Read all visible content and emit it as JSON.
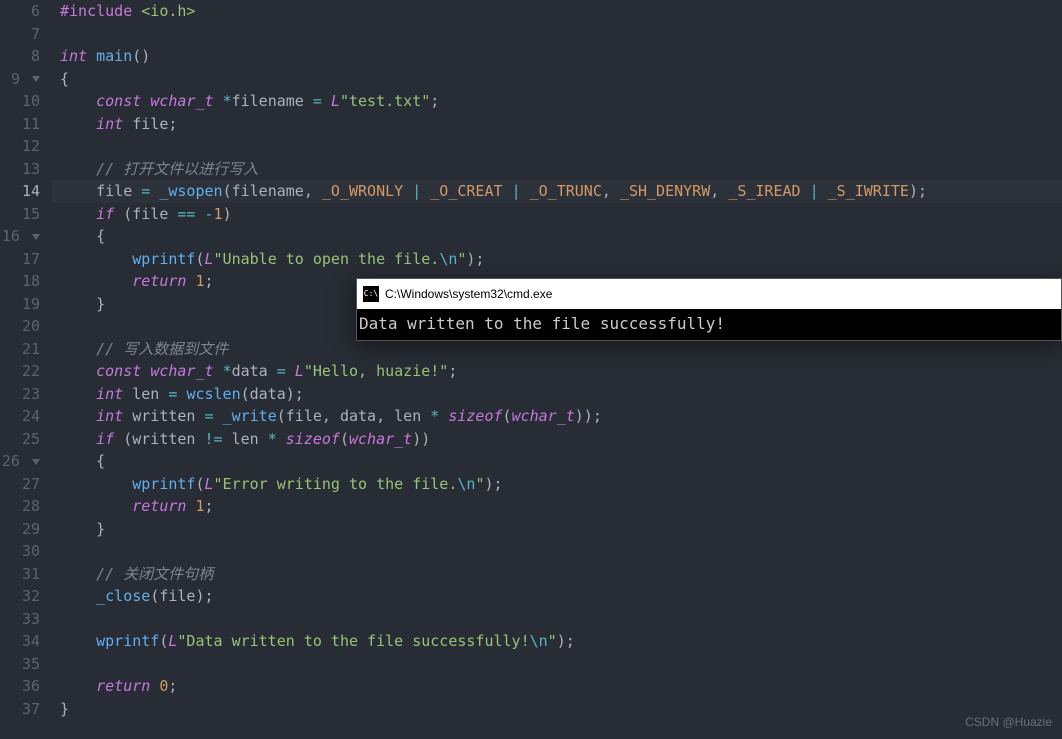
{
  "gutter": {
    "start": 6,
    "end": 37,
    "activeLine": 14,
    "foldLines": [
      9,
      16,
      26
    ]
  },
  "code": {
    "lines": [
      {
        "num": 6,
        "tokens": [
          [
            "preproc",
            "#include"
          ],
          [
            "plain",
            " "
          ],
          [
            "incstr",
            "<io.h>"
          ]
        ]
      },
      {
        "num": 7,
        "tokens": []
      },
      {
        "num": 8,
        "tokens": [
          [
            "type",
            "int"
          ],
          [
            "plain",
            " "
          ],
          [
            "func",
            "main"
          ],
          [
            "punc",
            "()"
          ]
        ]
      },
      {
        "num": 9,
        "tokens": [
          [
            "punc",
            "{"
          ]
        ]
      },
      {
        "num": 10,
        "tokens": [
          [
            "plain",
            "    "
          ],
          [
            "kw",
            "const"
          ],
          [
            "plain",
            " "
          ],
          [
            "type",
            "wchar_t"
          ],
          [
            "plain",
            " "
          ],
          [
            "op",
            "*"
          ],
          [
            "plain",
            "filename "
          ],
          [
            "op",
            "="
          ],
          [
            "plain",
            " "
          ],
          [
            "strprefix",
            "L"
          ],
          [
            "str",
            "\"test.txt\""
          ],
          [
            "punc",
            ";"
          ]
        ]
      },
      {
        "num": 11,
        "tokens": [
          [
            "plain",
            "    "
          ],
          [
            "type",
            "int"
          ],
          [
            "plain",
            " file"
          ],
          [
            "punc",
            ";"
          ]
        ]
      },
      {
        "num": 12,
        "tokens": []
      },
      {
        "num": 13,
        "tokens": [
          [
            "plain",
            "    "
          ],
          [
            "cmt",
            "// 打开文件以进行写入"
          ]
        ]
      },
      {
        "num": 14,
        "highlight": true,
        "tokens": [
          [
            "plain",
            "    file "
          ],
          [
            "op",
            "="
          ],
          [
            "plain",
            " "
          ],
          [
            "func",
            "_wsopen"
          ],
          [
            "punc",
            "("
          ],
          [
            "plain",
            "filename"
          ],
          [
            "punc",
            ", "
          ],
          [
            "const",
            "_O_WRONLY"
          ],
          [
            "plain",
            " "
          ],
          [
            "op",
            "|"
          ],
          [
            "plain",
            " "
          ],
          [
            "const",
            "_O_CREAT"
          ],
          [
            "plain",
            " "
          ],
          [
            "op",
            "|"
          ],
          [
            "plain",
            " "
          ],
          [
            "const",
            "_O_TRUNC"
          ],
          [
            "punc",
            ", "
          ],
          [
            "const",
            "_SH_DENYRW"
          ],
          [
            "punc",
            ", "
          ],
          [
            "const",
            "_S_IREAD"
          ],
          [
            "plain",
            " "
          ],
          [
            "op",
            "|"
          ],
          [
            "plain",
            " "
          ],
          [
            "const",
            "_S_IWRITE"
          ],
          [
            "punc",
            ");"
          ]
        ]
      },
      {
        "num": 15,
        "tokens": [
          [
            "plain",
            "    "
          ],
          [
            "kw",
            "if"
          ],
          [
            "plain",
            " "
          ],
          [
            "punc",
            "("
          ],
          [
            "plain",
            "file "
          ],
          [
            "op",
            "=="
          ],
          [
            "plain",
            " "
          ],
          [
            "op",
            "-"
          ],
          [
            "num",
            "1"
          ],
          [
            "punc",
            ")"
          ]
        ]
      },
      {
        "num": 16,
        "tokens": [
          [
            "plain",
            "    "
          ],
          [
            "punc",
            "{"
          ]
        ]
      },
      {
        "num": 17,
        "tokens": [
          [
            "plain",
            "        "
          ],
          [
            "func",
            "wprintf"
          ],
          [
            "punc",
            "("
          ],
          [
            "strprefix",
            "L"
          ],
          [
            "str",
            "\"Unable to open the file."
          ],
          [
            "esc",
            "\\n"
          ],
          [
            "str",
            "\""
          ],
          [
            "punc",
            ");"
          ]
        ]
      },
      {
        "num": 18,
        "tokens": [
          [
            "plain",
            "        "
          ],
          [
            "kw",
            "return"
          ],
          [
            "plain",
            " "
          ],
          [
            "num",
            "1"
          ],
          [
            "punc",
            ";"
          ]
        ]
      },
      {
        "num": 19,
        "tokens": [
          [
            "plain",
            "    "
          ],
          [
            "punc",
            "}"
          ]
        ]
      },
      {
        "num": 20,
        "tokens": []
      },
      {
        "num": 21,
        "tokens": [
          [
            "plain",
            "    "
          ],
          [
            "cmt",
            "// 写入数据到文件"
          ]
        ]
      },
      {
        "num": 22,
        "tokens": [
          [
            "plain",
            "    "
          ],
          [
            "kw",
            "const"
          ],
          [
            "plain",
            " "
          ],
          [
            "type",
            "wchar_t"
          ],
          [
            "plain",
            " "
          ],
          [
            "op",
            "*"
          ],
          [
            "plain",
            "data "
          ],
          [
            "op",
            "="
          ],
          [
            "plain",
            " "
          ],
          [
            "strprefix",
            "L"
          ],
          [
            "str",
            "\"Hello, huazie!\""
          ],
          [
            "punc",
            ";"
          ]
        ]
      },
      {
        "num": 23,
        "tokens": [
          [
            "plain",
            "    "
          ],
          [
            "type",
            "int"
          ],
          [
            "plain",
            " len "
          ],
          [
            "op",
            "="
          ],
          [
            "plain",
            " "
          ],
          [
            "func",
            "wcslen"
          ],
          [
            "punc",
            "("
          ],
          [
            "plain",
            "data"
          ],
          [
            "punc",
            ");"
          ]
        ]
      },
      {
        "num": 24,
        "tokens": [
          [
            "plain",
            "    "
          ],
          [
            "type",
            "int"
          ],
          [
            "plain",
            " written "
          ],
          [
            "op",
            "="
          ],
          [
            "plain",
            " "
          ],
          [
            "func",
            "_write"
          ],
          [
            "punc",
            "("
          ],
          [
            "plain",
            "file"
          ],
          [
            "punc",
            ", "
          ],
          [
            "plain",
            "data"
          ],
          [
            "punc",
            ", "
          ],
          [
            "plain",
            "len "
          ],
          [
            "op",
            "*"
          ],
          [
            "plain",
            " "
          ],
          [
            "kw",
            "sizeof"
          ],
          [
            "punc",
            "("
          ],
          [
            "type",
            "wchar_t"
          ],
          [
            "punc",
            "));"
          ]
        ]
      },
      {
        "num": 25,
        "tokens": [
          [
            "plain",
            "    "
          ],
          [
            "kw",
            "if"
          ],
          [
            "plain",
            " "
          ],
          [
            "punc",
            "("
          ],
          [
            "plain",
            "written "
          ],
          [
            "op",
            "!="
          ],
          [
            "plain",
            " len "
          ],
          [
            "op",
            "*"
          ],
          [
            "plain",
            " "
          ],
          [
            "kw",
            "sizeof"
          ],
          [
            "punc",
            "("
          ],
          [
            "type",
            "wchar_t"
          ],
          [
            "punc",
            "))"
          ]
        ]
      },
      {
        "num": 26,
        "tokens": [
          [
            "plain",
            "    "
          ],
          [
            "punc",
            "{"
          ]
        ]
      },
      {
        "num": 27,
        "tokens": [
          [
            "plain",
            "        "
          ],
          [
            "func",
            "wprintf"
          ],
          [
            "punc",
            "("
          ],
          [
            "strprefix",
            "L"
          ],
          [
            "str",
            "\"Error writing to the file."
          ],
          [
            "esc",
            "\\n"
          ],
          [
            "str",
            "\""
          ],
          [
            "punc",
            ");"
          ]
        ]
      },
      {
        "num": 28,
        "tokens": [
          [
            "plain",
            "        "
          ],
          [
            "kw",
            "return"
          ],
          [
            "plain",
            " "
          ],
          [
            "num",
            "1"
          ],
          [
            "punc",
            ";"
          ]
        ]
      },
      {
        "num": 29,
        "tokens": [
          [
            "plain",
            "    "
          ],
          [
            "punc",
            "}"
          ]
        ]
      },
      {
        "num": 30,
        "tokens": []
      },
      {
        "num": 31,
        "tokens": [
          [
            "plain",
            "    "
          ],
          [
            "cmt",
            "// 关闭文件句柄"
          ]
        ]
      },
      {
        "num": 32,
        "tokens": [
          [
            "plain",
            "    "
          ],
          [
            "func",
            "_close"
          ],
          [
            "punc",
            "("
          ],
          [
            "plain",
            "file"
          ],
          [
            "punc",
            ");"
          ]
        ]
      },
      {
        "num": 33,
        "tokens": []
      },
      {
        "num": 34,
        "tokens": [
          [
            "plain",
            "    "
          ],
          [
            "func",
            "wprintf"
          ],
          [
            "punc",
            "("
          ],
          [
            "strprefix",
            "L"
          ],
          [
            "str",
            "\"Data written to the file successfully!"
          ],
          [
            "esc",
            "\\n"
          ],
          [
            "str",
            "\""
          ],
          [
            "punc",
            ");"
          ]
        ]
      },
      {
        "num": 35,
        "tokens": []
      },
      {
        "num": 36,
        "tokens": [
          [
            "plain",
            "    "
          ],
          [
            "kw",
            "return"
          ],
          [
            "plain",
            " "
          ],
          [
            "num",
            "0"
          ],
          [
            "punc",
            ";"
          ]
        ]
      },
      {
        "num": 37,
        "tokens": [
          [
            "punc",
            "}"
          ]
        ]
      }
    ]
  },
  "cmd": {
    "title": "C:\\Windows\\system32\\cmd.exe",
    "iconText": "C:\\",
    "output": "Data written to the file successfully!"
  },
  "watermark": "CSDN @Huazie"
}
